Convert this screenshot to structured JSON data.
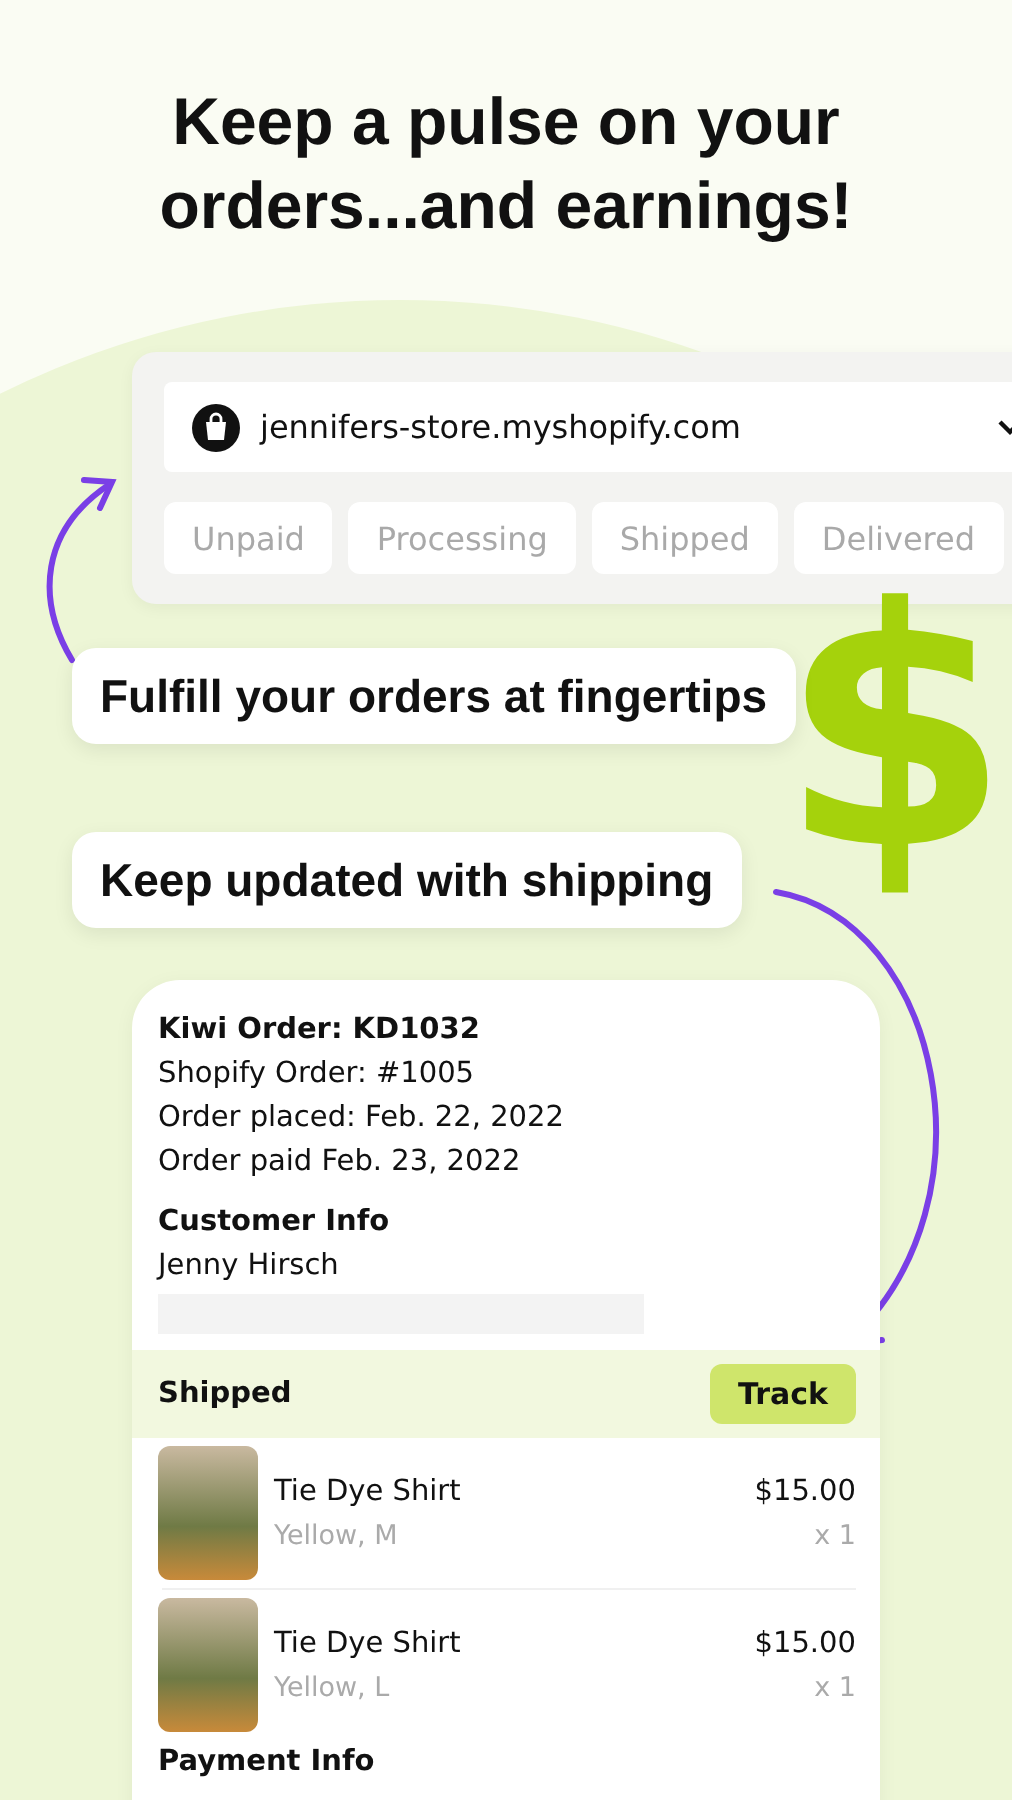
{
  "headline": "Keep a pulse on your orders...and earnings!",
  "store_selector": {
    "store": "jennifers-store.myshopify.com"
  },
  "status_tabs": [
    {
      "label": "Unpaid",
      "selected": false
    },
    {
      "label": "Processing",
      "selected": false
    },
    {
      "label": "Shipped",
      "selected": false
    },
    {
      "label": "Delivered",
      "selected": false
    }
  ],
  "decoration_symbol": "$",
  "callouts": [
    "Fulfill your orders at fingertips",
    "Keep updated with shipping"
  ],
  "order": {
    "kiwi_order_label": "Kiwi Order:",
    "kiwi_order": "KD1032",
    "shopify_order": "Shopify Order: #1005",
    "order_placed": "Order placed: Feb. 22, 2022",
    "order_paid": "Order paid Feb. 23, 2022",
    "customer_heading": "Customer Info",
    "customer_name": "Jenny Hirsch",
    "status": "Shipped",
    "track_button": "Track",
    "items": [
      {
        "name": "Tie Dye Shirt",
        "variant": "Yellow, M",
        "price": "$15.00",
        "quantity": "x 1"
      },
      {
        "name": "Tie Dye Shirt",
        "variant": "Yellow, L",
        "price": "$15.00",
        "quantity": "x 1"
      }
    ],
    "payment_heading": "Payment Info"
  }
}
